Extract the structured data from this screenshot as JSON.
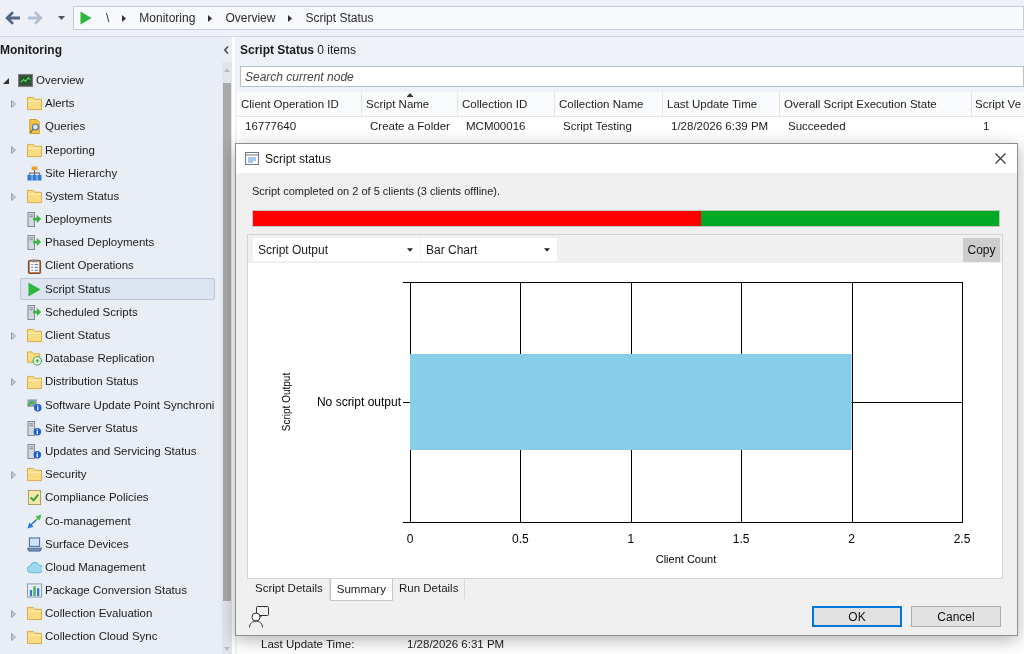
{
  "navigation": {
    "buttons": [
      {
        "kind": "back",
        "disabled": false
      },
      {
        "kind": "forward",
        "disabled": true
      }
    ],
    "breadcrumb": [
      "\\",
      "Monitoring",
      "Overview",
      "Script Status"
    ]
  },
  "sidebar": {
    "title": "Monitoring",
    "items": [
      {
        "label": "Overview",
        "kind": "overview",
        "expanded": true,
        "selected": false,
        "children": [
          {
            "label": "Alerts",
            "kind": "folder",
            "expandable": true,
            "selected": false
          },
          {
            "label": "Queries",
            "kind": "query",
            "expandable": false,
            "selected": false
          },
          {
            "label": "Reporting",
            "kind": "folder",
            "expandable": true,
            "selected": false
          },
          {
            "label": "Site Hierarchy",
            "kind": "hierarchy",
            "expandable": false,
            "selected": false
          },
          {
            "label": "System Status",
            "kind": "folder",
            "expandable": true,
            "selected": false
          },
          {
            "label": "Deployments",
            "kind": "deployment",
            "expandable": false,
            "selected": false
          },
          {
            "label": "Phased Deployments",
            "kind": "deployment",
            "expandable": false,
            "selected": false
          },
          {
            "label": "Client Operations",
            "kind": "operations",
            "expandable": false,
            "selected": false
          },
          {
            "label": "Script Status",
            "kind": "script",
            "expandable": false,
            "selected": true
          },
          {
            "label": "Scheduled Scripts",
            "kind": "deployment",
            "expandable": false,
            "selected": false
          },
          {
            "label": "Client Status",
            "kind": "folder",
            "expandable": true,
            "selected": false
          },
          {
            "label": "Database Replication",
            "kind": "replication",
            "expandable": false,
            "selected": false
          },
          {
            "label": "Distribution Status",
            "kind": "folder",
            "expandable": true,
            "selected": false
          },
          {
            "label": "Software Update Point Synchroni",
            "kind": "sync",
            "expandable": false,
            "selected": false
          },
          {
            "label": "Site Server Status",
            "kind": "server",
            "expandable": false,
            "selected": false
          },
          {
            "label": "Updates and Servicing Status",
            "kind": "server",
            "expandable": false,
            "selected": false
          },
          {
            "label": "Security",
            "kind": "folder",
            "expandable": true,
            "selected": false
          },
          {
            "label": "Compliance Policies",
            "kind": "compliance",
            "expandable": false,
            "selected": false
          },
          {
            "label": "Co-management",
            "kind": "comanagement",
            "expandable": false,
            "selected": false
          },
          {
            "label": "Surface Devices",
            "kind": "device",
            "expandable": false,
            "selected": false
          },
          {
            "label": "Cloud Management",
            "kind": "cloud",
            "expandable": false,
            "selected": false
          },
          {
            "label": "Package Conversion Status",
            "kind": "report",
            "expandable": false,
            "selected": false
          },
          {
            "label": "Collection Evaluation",
            "kind": "folder",
            "expandable": true,
            "selected": false
          },
          {
            "label": "Collection Cloud Sync",
            "kind": "folder",
            "expandable": true,
            "selected": false
          }
        ]
      }
    ]
  },
  "content": {
    "header": "**Script Status** 0 items",
    "search": {
      "placeholder": "Search current node"
    },
    "table": {
      "columns": [
        {
          "label": "Client Operation ID",
          "sorted": false
        },
        {
          "label": "Script Name",
          "sorted": true
        },
        {
          "label": "Collection ID",
          "sorted": false
        },
        {
          "label": "Collection Name",
          "sorted": false
        },
        {
          "label": "Last Update Time",
          "sorted": false
        },
        {
          "label": "Overall Script Execution State",
          "sorted": false
        },
        {
          "label": "Script Ve",
          "sorted": false
        }
      ],
      "rows": [
        [
          "16777640",
          "Create a Folder",
          "MCM00016",
          "Script Testing",
          "1/28/2026 6:39 PM",
          "Succeeded",
          "1"
        ]
      ]
    },
    "details": [
      {
        "label": "Last Update Time:",
        "value": "1/28/2026 6:31 PM"
      }
    ]
  },
  "dialog": {
    "title": "Script status",
    "message": "Script completed on 2 of 5 clients (3 clients offline).",
    "progress": {
      "level": 0.4
    },
    "dropdowns": [
      {
        "value": "Script Output"
      },
      {
        "value": "Bar Chart"
      }
    ],
    "copy_button": "Copy",
    "chart_data": {
      "type": "bar",
      "orientation": "horizontal",
      "xlabel": "Client Count",
      "ylabel": "Script Output",
      "categories": [
        "No script output"
      ],
      "values": [
        2
      ],
      "xlim": [
        0,
        2.5
      ],
      "xticks": [
        0,
        0.5,
        1,
        1.5,
        2,
        2.5
      ],
      "grid": true
    },
    "tabs": [
      {
        "label": "Script Details",
        "selected": false
      },
      {
        "label": "Summary",
        "selected": true
      },
      {
        "label": "Run Details",
        "selected": false
      }
    ],
    "buttons": [
      {
        "label": "OK",
        "default": true
      },
      {
        "label": "Cancel",
        "default": false
      }
    ]
  }
}
